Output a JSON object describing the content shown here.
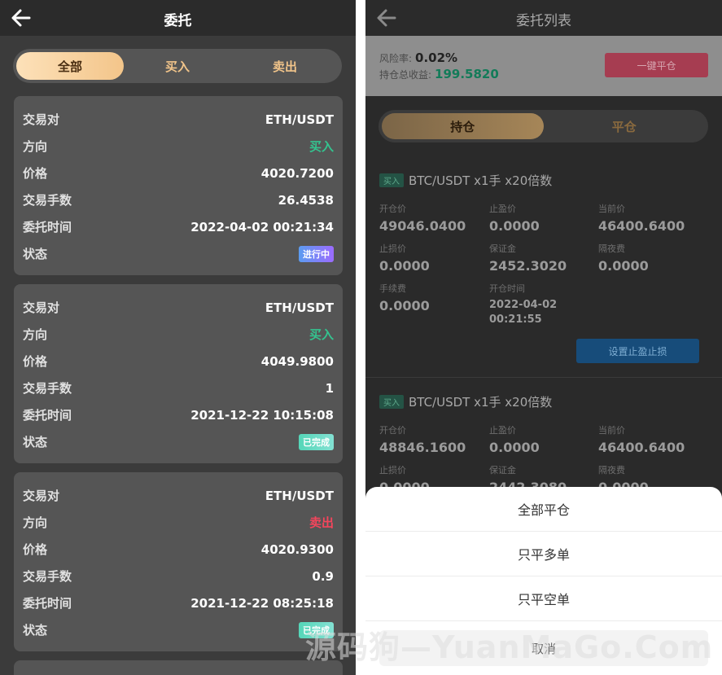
{
  "left": {
    "header": {
      "title": "委托"
    },
    "tabs": [
      {
        "label": "全部"
      },
      {
        "label": "买入"
      },
      {
        "label": "卖出"
      }
    ],
    "labels": {
      "pair": "交易对",
      "direction": "方向",
      "price": "价格",
      "amount": "交易手数",
      "time": "委托时间",
      "status": "状态"
    },
    "orders": [
      {
        "pair": "ETH/USDT",
        "direction": "买入",
        "price": "4020.7200",
        "amount": "26.4538",
        "time": "2022-04-02 00:21:34",
        "status": "进行中"
      },
      {
        "pair": "ETH/USDT",
        "direction": "买入",
        "price": "4049.9800",
        "amount": "1",
        "time": "2021-12-22 10:15:08",
        "status": "已完成"
      },
      {
        "pair": "ETH/USDT",
        "direction": "卖出",
        "price": "4020.9300",
        "amount": "0.9",
        "time": "2021-12-22 08:25:18",
        "status": "已完成"
      }
    ]
  },
  "right": {
    "header": {
      "title": "委托列表"
    },
    "risk": {
      "risk_label": "风险率:",
      "risk_value": "0.02%",
      "profit_label": "持仓总收益:",
      "profit_value": "199.5820",
      "close_all_btn": "一键平仓"
    },
    "tabs": [
      {
        "label": "持仓"
      },
      {
        "label": "平仓"
      }
    ],
    "field_labels": {
      "open_price": "开仓价",
      "take_profit": "止盈价",
      "current_price": "当前价",
      "stop_loss": "止损价",
      "margin": "保证金",
      "overnight_fee": "隔夜费",
      "fee": "手续费",
      "open_time": "开仓时间"
    },
    "positions": [
      {
        "tag": "买入",
        "symbol": "BTC/USDT x1手 x20倍数",
        "open_price": "49046.0400",
        "take_profit": "0.0000",
        "current_price": "46400.6400",
        "stop_loss": "0.0000",
        "margin": "2452.3020",
        "overnight_fee": "0.0000",
        "fee": "0.0000",
        "open_time_date": "2022-04-02",
        "open_time_clock": "00:21:55",
        "action": "设置止盈止损"
      },
      {
        "tag": "买入",
        "symbol": "BTC/USDT x1手 x20倍数",
        "open_price": "48846.1600",
        "take_profit": "0.0000",
        "current_price": "46400.6400",
        "stop_loss": "0.0000",
        "margin": "2442.3080",
        "overnight_fee": "0.0000"
      }
    ],
    "sheet": {
      "options": [
        "全部平仓",
        "只平多单",
        "只平空单"
      ],
      "cancel": "取消"
    }
  },
  "watermark": "源码狗—YuanMaGo.Com",
  "colors": {
    "buy": "#34c38f",
    "sell": "#f5455c",
    "accent_gold": "#f3c58a"
  }
}
